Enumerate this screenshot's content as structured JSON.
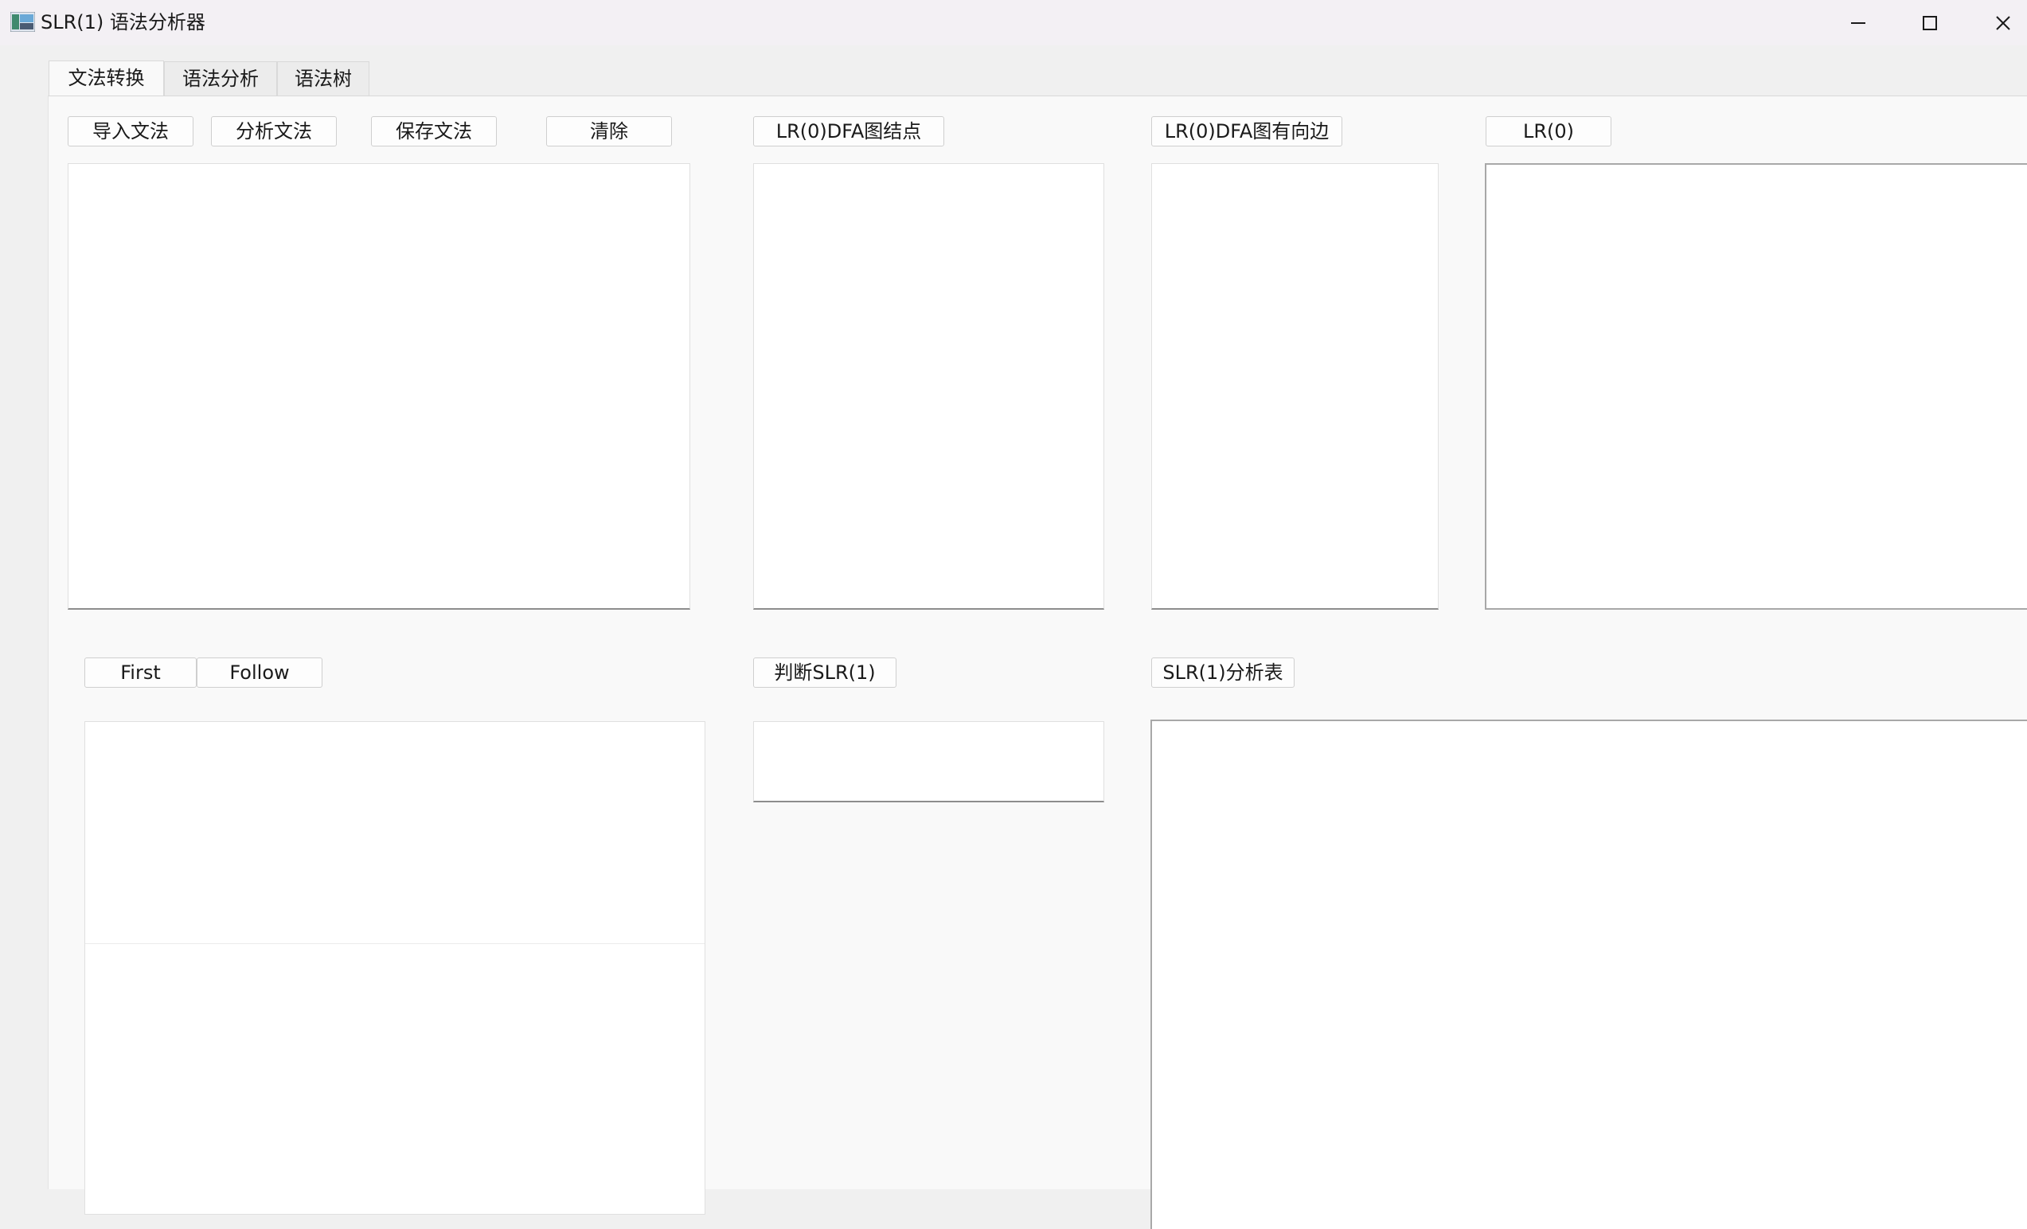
{
  "window": {
    "title": "SLR(1) 语法分析器",
    "controls": {
      "minimize_icon": "minimize-icon",
      "maximize_icon": "maximize-icon",
      "close_icon": "close-icon"
    }
  },
  "tabs": [
    {
      "label": "文法转换",
      "active": true
    },
    {
      "label": "语法分析",
      "active": false
    },
    {
      "label": "语法树",
      "active": false
    }
  ],
  "toolbar": {
    "import_label": "导入文法",
    "analyze_label": "分析文法",
    "save_label": "保存文法",
    "clear_label": "清除"
  },
  "lr0": {
    "nodes_label": "LR(0)DFA图结点",
    "edges_label": "LR(0)DFA图有向边",
    "lr0_label": "LR(0)"
  },
  "sets": {
    "first_label": "First",
    "follow_label": "Follow"
  },
  "slr": {
    "judge_label": "判断SLR(1)",
    "table_label": "SLR(1)分析表"
  },
  "colors": {
    "titlebar": "#f3f0f4",
    "pane": "#f9f9f9",
    "textbox": "#ffffff"
  }
}
